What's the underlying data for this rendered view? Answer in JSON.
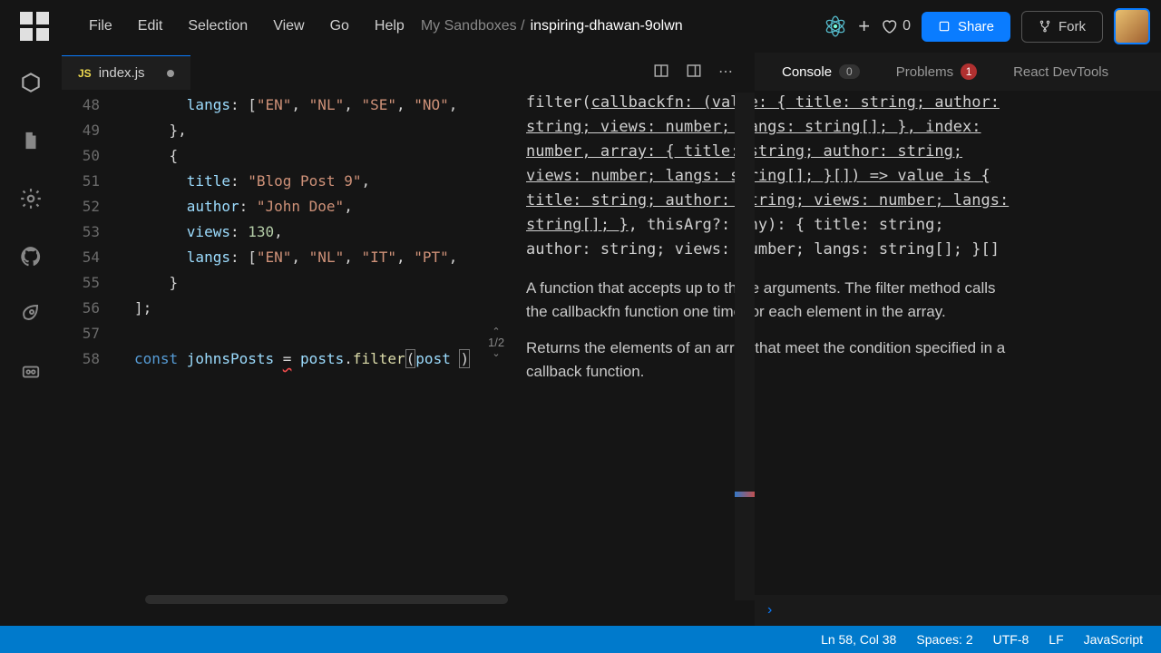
{
  "menu": {
    "items": [
      "File",
      "Edit",
      "Selection",
      "View",
      "Go",
      "Help"
    ],
    "breadcrumb_sub": "My Sandboxes /",
    "breadcrumb_main": "inspiring-dhawan-9olwn",
    "likes": "0",
    "share": "Share",
    "fork": "Fork"
  },
  "tab": {
    "badge": "JS",
    "filename": "index.js"
  },
  "panel": {
    "console": "Console",
    "console_count": "0",
    "problems": "Problems",
    "problems_count": "1",
    "react": "React DevTools"
  },
  "code": {
    "lines": [
      {
        "n": "48",
        "indent": "      ",
        "tokens": [
          [
            "prop",
            "langs"
          ],
          [
            "punc",
            ": ["
          ],
          [
            "str",
            "\"EN\""
          ],
          [
            "punc",
            ", "
          ],
          [
            "str",
            "\"NL\""
          ],
          [
            "punc",
            ", "
          ],
          [
            "str",
            "\"SE\""
          ],
          [
            "punc",
            ", "
          ],
          [
            "str",
            "\"NO\""
          ],
          [
            "punc",
            ","
          ]
        ]
      },
      {
        "n": "49",
        "indent": "    ",
        "tokens": [
          [
            "punc",
            "},"
          ]
        ]
      },
      {
        "n": "50",
        "indent": "    ",
        "tokens": [
          [
            "punc",
            "{"
          ]
        ]
      },
      {
        "n": "51",
        "indent": "      ",
        "tokens": [
          [
            "prop",
            "title"
          ],
          [
            "punc",
            ": "
          ],
          [
            "str",
            "\"Blog Post 9\""
          ],
          [
            "punc",
            ","
          ]
        ]
      },
      {
        "n": "52",
        "indent": "      ",
        "tokens": [
          [
            "prop",
            "author"
          ],
          [
            "punc",
            ": "
          ],
          [
            "str",
            "\"John Doe\""
          ],
          [
            "punc",
            ","
          ]
        ]
      },
      {
        "n": "53",
        "indent": "      ",
        "tokens": [
          [
            "prop",
            "views"
          ],
          [
            "punc",
            ": "
          ],
          [
            "num",
            "130"
          ],
          [
            "punc",
            ","
          ]
        ]
      },
      {
        "n": "54",
        "indent": "      ",
        "tokens": [
          [
            "prop",
            "langs"
          ],
          [
            "punc",
            ": ["
          ],
          [
            "str",
            "\"EN\""
          ],
          [
            "punc",
            ", "
          ],
          [
            "str",
            "\"NL\""
          ],
          [
            "punc",
            ", "
          ],
          [
            "str",
            "\"IT\""
          ],
          [
            "punc",
            ", "
          ],
          [
            "str",
            "\"PT\""
          ],
          [
            "punc",
            ","
          ]
        ]
      },
      {
        "n": "55",
        "indent": "    ",
        "tokens": [
          [
            "punc",
            "}"
          ]
        ]
      },
      {
        "n": "56",
        "indent": "",
        "tokens": [
          [
            "punc",
            "];"
          ]
        ]
      },
      {
        "n": "57",
        "indent": "",
        "tokens": []
      },
      {
        "n": "58",
        "indent": "",
        "tokens": [
          [
            "key",
            "const "
          ],
          [
            "var",
            "johnsPosts"
          ],
          [
            "punc",
            " "
          ],
          [
            "squiggle",
            "="
          ],
          [
            "punc",
            " "
          ],
          [
            "var",
            "posts"
          ],
          [
            "punc",
            "."
          ],
          [
            "func",
            "filter"
          ],
          [
            "bracket",
            "("
          ],
          [
            "var",
            "post "
          ],
          [
            "bracket",
            ")"
          ]
        ]
      }
    ]
  },
  "pager": "1/2",
  "signature": {
    "line1_pre": "filter(",
    "line1_ul": "callbackfn: (value: { title: string; author: string; views: number; langs: string[]; }, index: number, array: { title: string; author: string; views: number; langs: string[]; }[]) => value is { title: string; author: string; views: number; langs: string[]; }",
    "line1_post": ", thisArg?: any): { title: string; author: string; views: number; langs: string[]; }[]",
    "desc1": "A function that accepts up to three arguments. The filter method calls the callbackfn function one time for each element in the array.",
    "desc2": "Returns the elements of an array that meet the condition specified in a callback function."
  },
  "status": {
    "pos": "Ln 58, Col 38",
    "spaces": "Spaces: 2",
    "enc": "UTF-8",
    "eol": "LF",
    "lang": "JavaScript"
  }
}
